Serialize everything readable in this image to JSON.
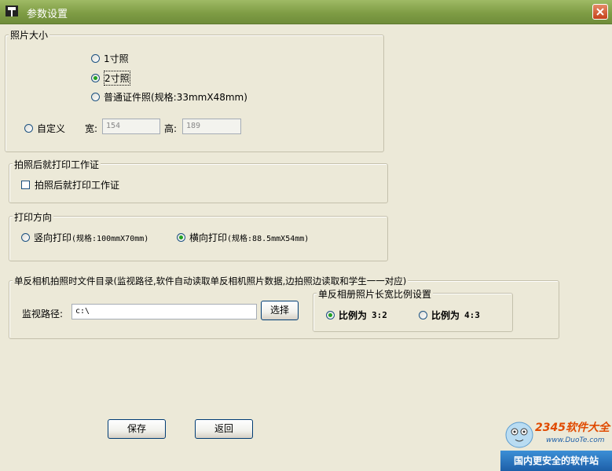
{
  "window": {
    "title": "参数设置",
    "close_icon": "close-icon",
    "app_icon": "camera-icon"
  },
  "photo_size": {
    "legend": "照片大小",
    "options": [
      "1寸照",
      "2寸照",
      "普通证件照(规格:33mmX48mm)"
    ],
    "selected": "2寸照",
    "custom_label": "自定义",
    "width_label": "宽:",
    "width_value": "154",
    "height_label": "高:",
    "height_value": "189"
  },
  "print_after": {
    "legend": "拍照后就打印工作证",
    "checkbox_label": "拍照后就打印工作证",
    "checked": false
  },
  "orientation": {
    "legend": "打印方向",
    "portrait_label": "竖向打印",
    "portrait_spec": "(规格:100mmX70mm)",
    "landscape_label": "横向打印",
    "landscape_spec": "(规格:88.5mmX54mm)",
    "selected": "横向打印"
  },
  "watch": {
    "legend": "单反相机拍照时文件目录(监视路径,软件自动读取单反相机照片数据,边拍照边读取和学生一一对应)",
    "path_label": "监视路径:",
    "path_value": "c:\\",
    "select_button": "选择"
  },
  "ratio": {
    "legend": "单反相册照片长宽比例设置",
    "option1_label": "比例为",
    "option1_value": "3:2",
    "option2_label": "比例为",
    "option2_value": "4:3",
    "selected": "3:2"
  },
  "buttons": {
    "save": "保存",
    "back": "返回"
  },
  "watermark": {
    "brand": "2345软件大全",
    "url": "www.DuoTe.com",
    "banner": "国内更安全的软件站"
  },
  "colors": {
    "titlebar": "#7f9d45",
    "dialog_bg": "#ECE9D8",
    "radio_dot": "#21a121"
  }
}
